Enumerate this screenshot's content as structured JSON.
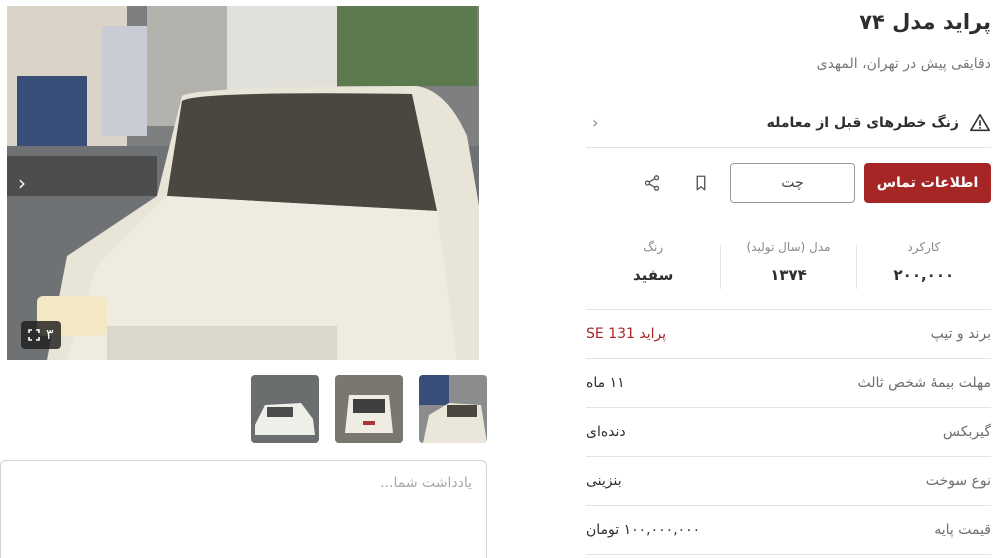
{
  "gallery": {
    "image_count": "۳",
    "thumbnails": [
      "thumb-1",
      "thumb-2",
      "thumb-3"
    ],
    "prev_icon": "chevron-left-icon",
    "expand_icon": "expand-icon"
  },
  "note": {
    "placeholder": "یادداشت شما..."
  },
  "listing": {
    "title": "پراید مدل ۷۴",
    "subtitle": "دقایقی پیش در تهران، المهدی",
    "warning": "زنگ خطرهای قبل از معامله"
  },
  "actions": {
    "contact_label": "اطلاعات تماس",
    "chat_label": "چت",
    "bookmark_icon": "bookmark-icon",
    "share_icon": "share-icon"
  },
  "stats": [
    {
      "label": "کارکرد",
      "value": "۲۰۰,۰۰۰"
    },
    {
      "label": "مدل (سال تولید)",
      "value": "۱۳۷۴"
    },
    {
      "label": "رنگ",
      "value": "سفید"
    }
  ],
  "specs": [
    {
      "key": "برند و تیپ",
      "value": "پراید 131 SE"
    },
    {
      "key": "مهلت بیمهٔ شخص ثالث",
      "value": "۱۱ ماه"
    },
    {
      "key": "گیربکس",
      "value": "دنده‌ای"
    },
    {
      "key": "نوع سوخت",
      "value": "بنزینی"
    },
    {
      "key": "قیمت پایه",
      "value": "۱۰۰,۰۰۰,۰۰۰ تومان"
    }
  ],
  "colors": {
    "accent": "#a62626",
    "divider": "#e4e4e4"
  }
}
